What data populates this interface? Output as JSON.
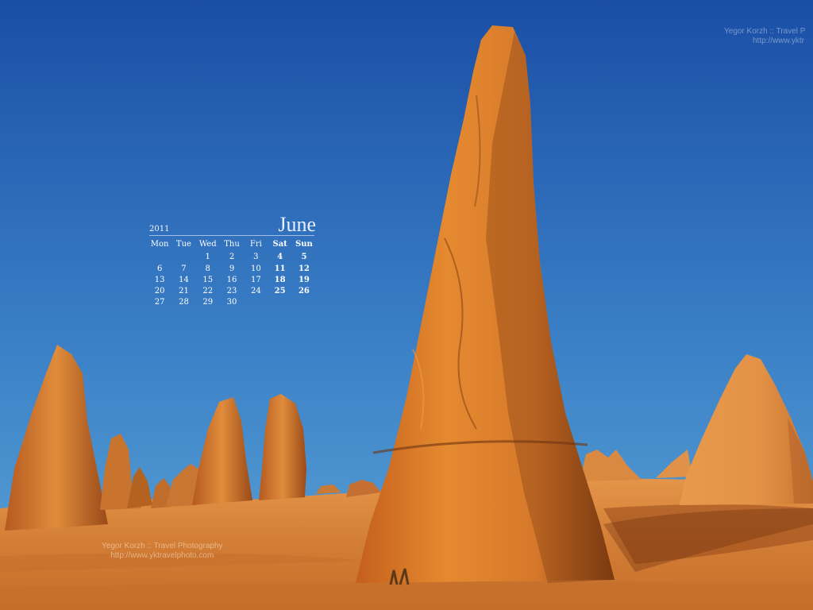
{
  "calendar": {
    "year": "2011",
    "month": "June",
    "weekdays": [
      "Mon",
      "Tue",
      "Wed",
      "Thu",
      "Fri",
      "Sat",
      "Sun"
    ],
    "weeks": [
      [
        "",
        "",
        "1",
        "2",
        "3",
        "4",
        "5"
      ],
      [
        "6",
        "7",
        "8",
        "9",
        "10",
        "11",
        "12"
      ],
      [
        "13",
        "14",
        "15",
        "16",
        "17",
        "18",
        "19"
      ],
      [
        "20",
        "21",
        "22",
        "23",
        "24",
        "25",
        "26"
      ],
      [
        "27",
        "28",
        "29",
        "30",
        "",
        "",
        ""
      ]
    ]
  },
  "watermarks": {
    "top": {
      "line1": "Yegor Korzh :: Travel P",
      "line2": "http://www.yktr"
    },
    "bottom": {
      "line1": "Yegor Korzh :: Travel Photography",
      "line2": "http://www.yktravelphoto.com"
    }
  },
  "colors": {
    "sky_top": "#1a4fa8",
    "sky_bottom": "#4f9ad0",
    "rock": "#d9822a",
    "sand": "#d68a3e"
  }
}
